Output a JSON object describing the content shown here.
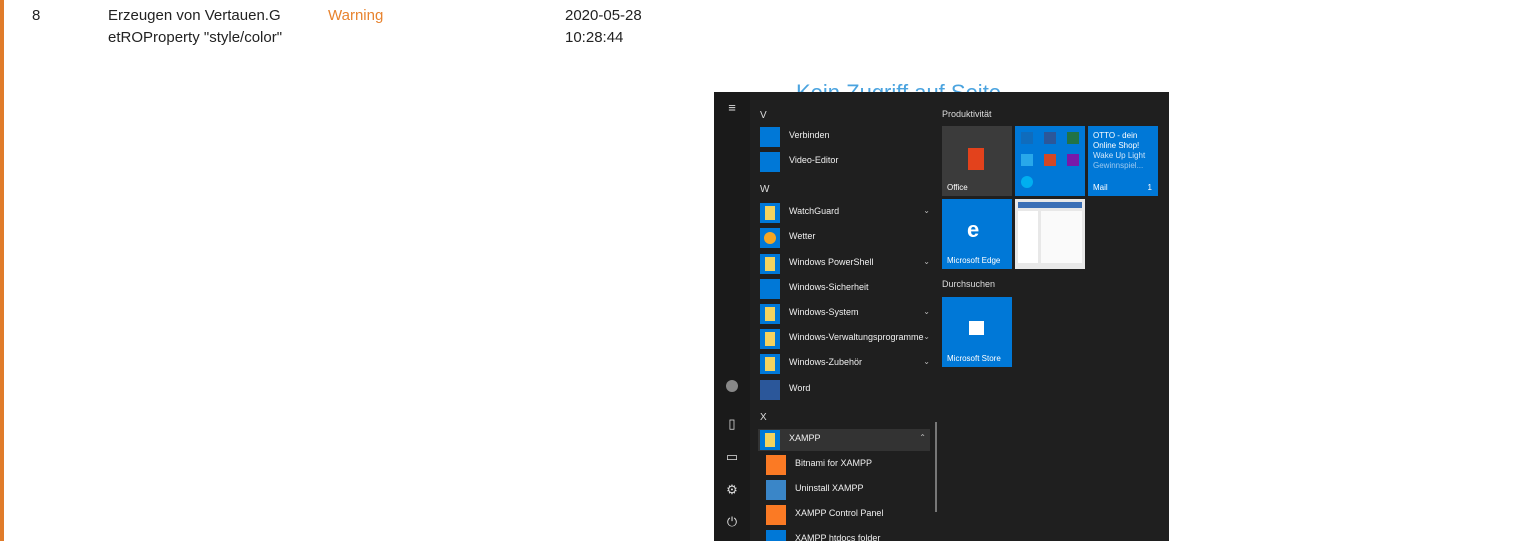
{
  "row": {
    "number": "8",
    "description": "Erzeugen von Vertauen.GetROProperty \"style/color\"",
    "level": "Warning",
    "date": "2020-05-28",
    "time": "10:28:44"
  },
  "start_menu": {
    "heading": "Kein Zugriff auf Seite",
    "letters": {
      "v": "V",
      "w": "W",
      "x": "X"
    },
    "apps": {
      "verbinden": "Verbinden",
      "video_editor": "Video-Editor",
      "watchguard": "WatchGuard",
      "wetter": "Wetter",
      "powershell": "Windows PowerShell",
      "sicherheit": "Windows-Sicherheit",
      "system": "Windows-System",
      "verwaltung": "Windows-Verwaltungsprogramme",
      "zubehoer": "Windows-Zubehör",
      "word": "Word",
      "xampp": "XAMPP",
      "bitnami": "Bitnami for XAMPP",
      "uninstall": "Uninstall XAMPP",
      "control_panel": "XAMPP Control Panel",
      "htdocs": "XAMPP htdocs folder"
    },
    "tiles": {
      "group_productivity": "Produktivität",
      "office": "Office",
      "mail": "Mail",
      "mail_count": "1",
      "otto_line1": "OTTO - dein",
      "otto_line2": "Online Shop!",
      "otto_line3": "Wake Up Light",
      "otto_line4": "Gewinnspiel...",
      "edge": "Microsoft Edge",
      "group_search": "Durchsuchen",
      "store": "Microsoft Store"
    },
    "colors": {
      "tile_blue": "#0078d7",
      "menu_bg": "#1f1f1f",
      "warning": "#e8832e"
    }
  }
}
